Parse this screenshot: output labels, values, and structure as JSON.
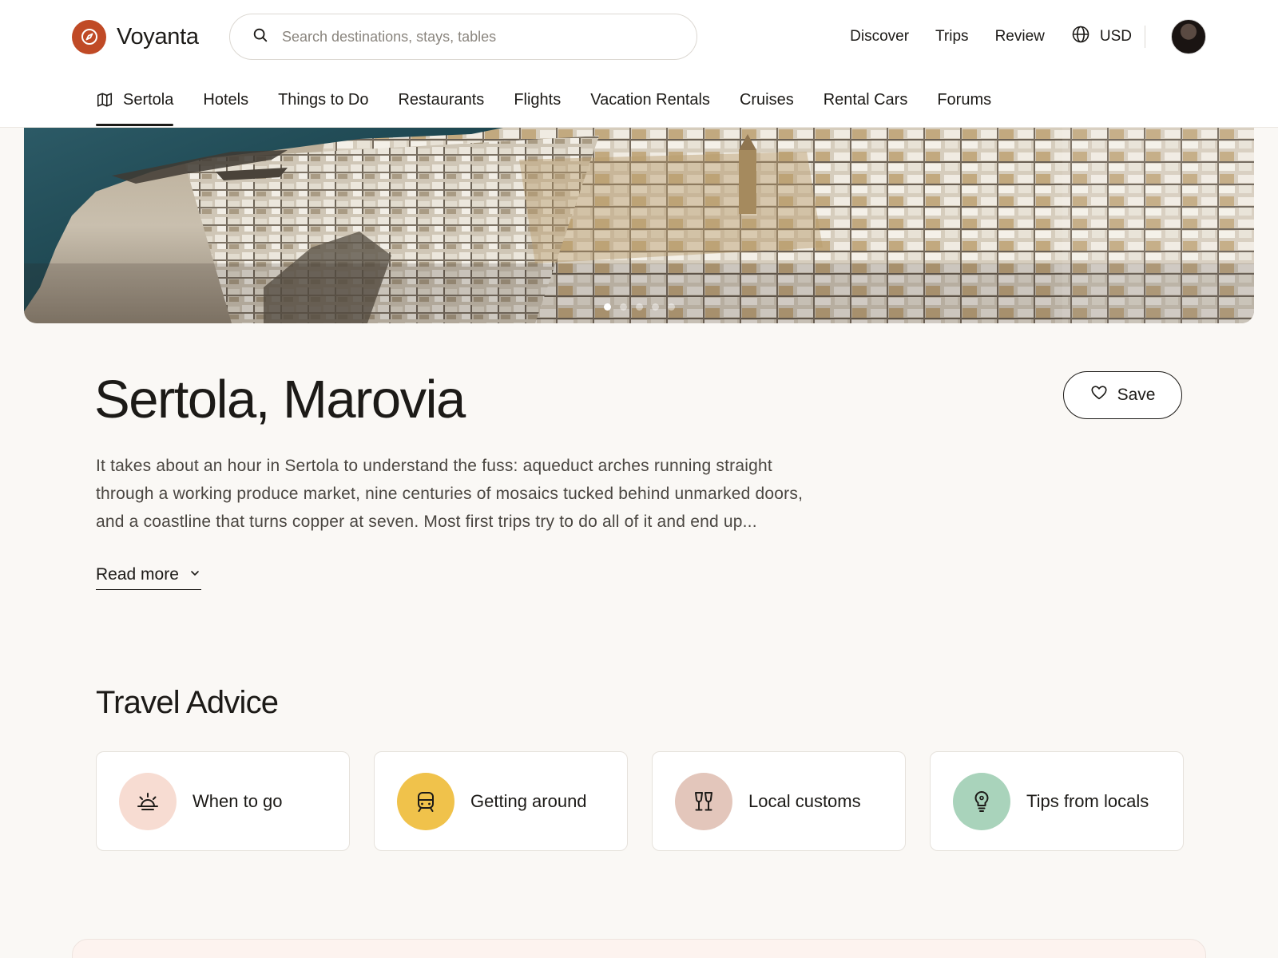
{
  "brand": {
    "name": "Voyanta",
    "logo_icon": "compass-icon",
    "accent": "#c04a26"
  },
  "search": {
    "placeholder": "Search destinations, stays, tables",
    "value": ""
  },
  "topnav": {
    "links": [
      "Discover",
      "Trips",
      "Review"
    ],
    "currency": "USD",
    "currency_icon": "globe-icon",
    "avatar": "user-avatar"
  },
  "categories": {
    "items": [
      {
        "label": "Sertola",
        "icon": "map-icon",
        "active": true
      },
      {
        "label": "Hotels"
      },
      {
        "label": "Things to Do"
      },
      {
        "label": "Restaurants"
      },
      {
        "label": "Flights"
      },
      {
        "label": "Vacation Rentals"
      },
      {
        "label": "Cruises"
      },
      {
        "label": "Rental Cars"
      },
      {
        "label": "Forums"
      }
    ]
  },
  "hero": {
    "slide_count": 5,
    "active_slide": 1
  },
  "destination": {
    "title": "Sertola, Marovia",
    "save_label": "Save",
    "description": "It takes about an hour in Sertola to understand the fuss: aqueduct arches running straight through a working produce market, nine centuries of mosaics tucked behind unmarked doors, and a coastline that turns copper at seven. Most first trips try to do all of it and end up...",
    "read_more": "Read more"
  },
  "travel_advice": {
    "title": "Travel Advice",
    "cards": [
      {
        "label": "When to go",
        "icon": "sunrise-icon",
        "color": "#f7dcd2"
      },
      {
        "label": "Getting around",
        "icon": "train-icon",
        "color": "#f0c24b"
      },
      {
        "label": "Local customs",
        "icon": "wine-glasses-icon",
        "color": "#e3c6bb"
      },
      {
        "label": "Tips from locals",
        "icon": "lightbulb-icon",
        "color": "#a9d3bb"
      }
    ]
  }
}
